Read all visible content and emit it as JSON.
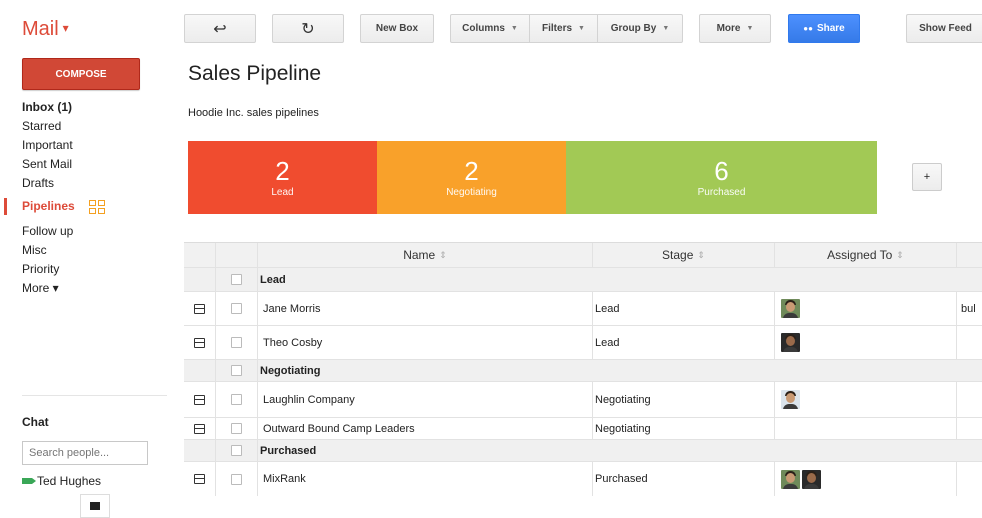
{
  "app": {
    "title": "Mail"
  },
  "compose_label": "COMPOSE",
  "nav": [
    {
      "label": "Inbox (1)",
      "bold": true
    },
    {
      "label": "Starred"
    },
    {
      "label": "Important"
    },
    {
      "label": "Sent Mail"
    },
    {
      "label": "Drafts"
    },
    {
      "label": "Pipelines",
      "active": true
    },
    {
      "label": "Follow up"
    },
    {
      "label": "Misc"
    },
    {
      "label": "Priority"
    },
    {
      "label": "More ▾"
    }
  ],
  "chat": {
    "title": "Chat",
    "search_placeholder": "Search people...",
    "contacts": [
      {
        "name": "Ted Hughes",
        "status_color": "#3aa757"
      }
    ]
  },
  "toolbar": {
    "new_box": "New Box",
    "columns": "Columns",
    "filters": "Filters",
    "group_by": "Group By",
    "more": "More",
    "share": "Share",
    "show_feed": "Show Feed"
  },
  "pipeline": {
    "title": "Sales Pipeline",
    "description": "Hoodie Inc. sales pipelines",
    "add_label": "+",
    "stages": [
      {
        "count": "2",
        "label": "Lead",
        "color": "#f04c2f"
      },
      {
        "count": "2",
        "label": "Negotiating",
        "color": "#f9a12a"
      },
      {
        "count": "6",
        "label": "Purchased",
        "color": "#a2c955"
      }
    ]
  },
  "table": {
    "columns": [
      "Name",
      "Stage",
      "Assigned To"
    ],
    "groups": [
      {
        "name": "Lead",
        "rows": [
          {
            "name": "Jane Morris",
            "stage": "Lead",
            "extra": "bul",
            "avatars": [
              "person"
            ]
          },
          {
            "name": "Theo Cosby",
            "stage": "Lead",
            "extra": "",
            "avatars": [
              "person"
            ]
          }
        ]
      },
      {
        "name": "Negotiating",
        "rows": [
          {
            "name": "Laughlin Company",
            "stage": "Negotiating",
            "extra": "",
            "avatars": [
              "person"
            ]
          },
          {
            "name": "Outward Bound Camp Leaders",
            "stage": "Negotiating",
            "extra": "",
            "avatars": []
          }
        ]
      },
      {
        "name": "Purchased",
        "rows": [
          {
            "name": "MixRank",
            "stage": "Purchased",
            "extra": "",
            "avatars": [
              "person",
              "person"
            ]
          }
        ]
      }
    ]
  }
}
